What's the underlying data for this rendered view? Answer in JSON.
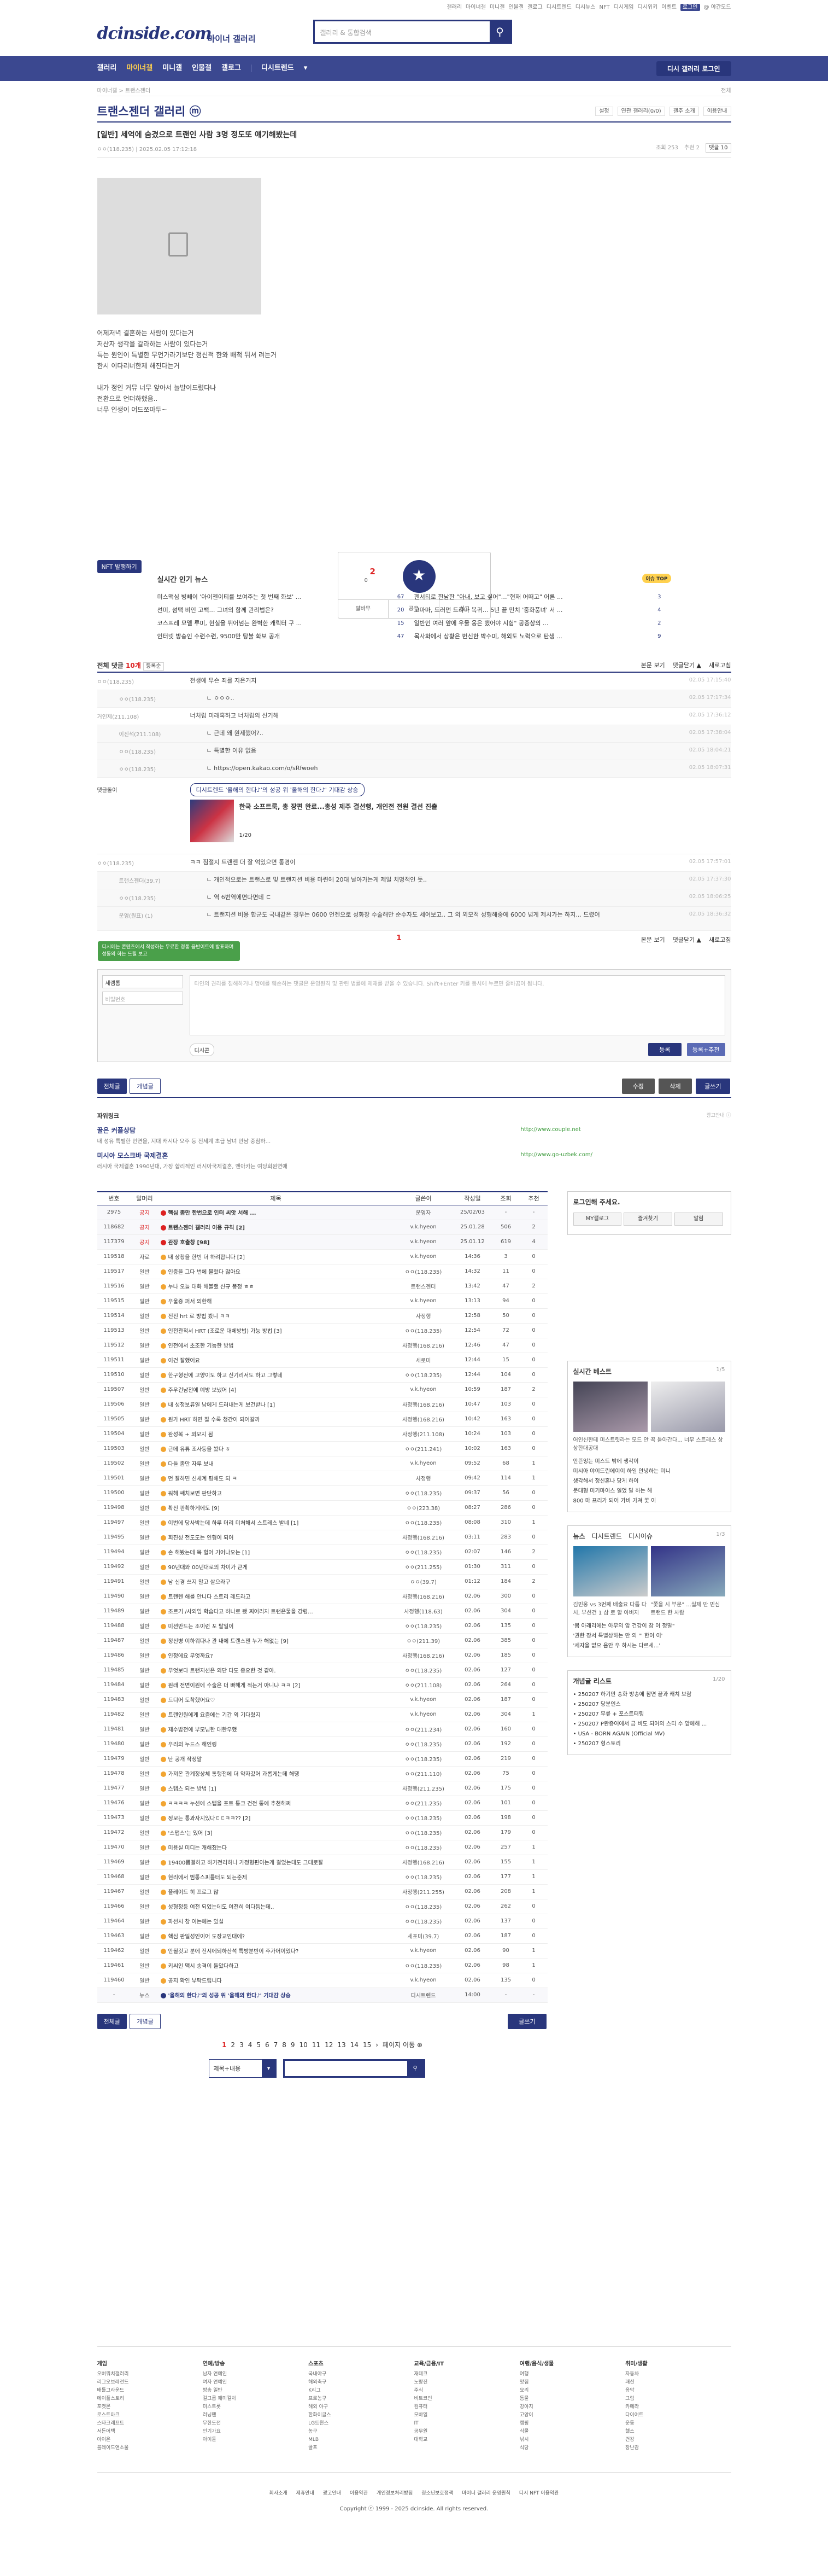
{
  "topnav": [
    "갤러리",
    "마이너갤",
    "미니갤",
    "인물갤",
    "갤로그",
    "디시트렌드",
    "디시뉴스",
    "NFT",
    "디시게임",
    "디시위키",
    "이벤트",
    "로그인",
    "@ 야간모드"
  ],
  "header": {
    "logo": "dcinside.com",
    "logo_sub": "마이너 갤러리",
    "search_placeholder": "갤러리 & 통합검색"
  },
  "gnb": {
    "items": [
      "갤러리",
      "마이너갤",
      "미니갤",
      "인물갤",
      "갤로그",
      "디시트렌드"
    ],
    "right": "디시 갤러리 로그인"
  },
  "crumb": {
    "left": "마이너갤 > 트랜스젠더",
    "right": "전체"
  },
  "gallery": {
    "title": "트랜스젠더 갤러리 ⓜ",
    "opts": [
      "설정",
      "연관 갤러리(0/0)",
      "갤주 소개",
      "이용안내"
    ]
  },
  "post": {
    "title": "[일반] 세억에 숨겼으로 트랜인 사람 3명 정도또 얘기해봤는데",
    "author": "ㅇㅇ(118.235)",
    "date": "2025.02.05 17:12:18",
    "views": "조회 253",
    "rec": "추천 2",
    "cmts": "댓글 10",
    "lines": [
      "어제저녁 결혼하는 사람이 있다는거",
      "저산자 생각을 갈라하는 사람이 있다는거",
      "특는 원인이 특별한 무언가라기보단 정신적 한와 배척 뒤셔 려는거",
      "한시 이다리너한제 해진다는거",
      "",
      "내가 정인 커뮤 너무 앞아서 늘발이드렸다나",
      "전환으로 언더하했음..",
      "너무 인생이 어드쪼마두~"
    ]
  },
  "nft": "NFT 발행하기",
  "vote": {
    "count": "2",
    "fixed": "0",
    "label": "추천",
    "buttons": [
      "알바무",
      "공유",
      "신고"
    ]
  },
  "news": {
    "title": "실시간 인기 뉴스",
    "tag": "이슈 TOP",
    "items": [
      {
        "t": "미스맥심 빙빼이 '아이젠이티를 보여주는 첫 번째 화보' ...",
        "c": "67"
      },
      {
        "t": "펜서티로 한남한 \"아내, 보고 싶어\"…\"현재 어떠고\" 어른 ...",
        "c": "3"
      },
      {
        "t": "선미, 섬택 비인 고백… 그녀의 함께 관리법은?",
        "c": "20"
      },
      {
        "t": "고마마, 드러먼 드라마 복귀… 5년 끝 만치 '중화풍녀' 서 ...",
        "c": "4"
      },
      {
        "t": "코스프레 모델 루미, 현실을 뛰어넘는 완벽한 캐릭터 구 ...",
        "c": "15"
      },
      {
        "t": "일반인 여러 앞에 우물 옹은 했어야 시험\" 공증상의 ...",
        "c": "2"
      },
      {
        "t": "인터넷 방송인 수련수련, 9500만 탕불 화보 공개",
        "c": "47"
      },
      {
        "t": "목사화에서 상황은 번신한 박수미, 해외도 노력으로 탄생 ...",
        "c": "9"
      }
    ]
  },
  "comments": {
    "label": "전체 댓글",
    "count": "10개",
    "sort": "등록순",
    "right": [
      "본문 보기",
      "댓글닫기 ▲",
      "새로고침"
    ],
    "rows": [
      {
        "n": "ㅇㅇ(118.235)",
        "t": "전생에 무슨 죄를 지은거지",
        "d": "02.05 17:15:40",
        "re": false
      },
      {
        "n": "ㅇㅇ(118.235)",
        "t": "ㄴ ㅇㅇㅇ..",
        "d": "02.05 17:17:34",
        "re": true
      },
      {
        "n": "거인제(211.108)",
        "t": "너처럼 미래혹하고 너처럼의 신기해",
        "d": "02.05 17:36:12",
        "re": false
      },
      {
        "n": "이진석(211.108)",
        "t": "ㄴ 근데 왜 원제했어?..",
        "d": "02.05 17:38:04",
        "re": true
      },
      {
        "n": "ㅇㅇ(118.235)",
        "t": "ㄴ 특별한 이유 없음",
        "d": "02.05 18:04:21",
        "re": true
      },
      {
        "n": "ㅇㅇ(118.235)",
        "t": "ㄴ https://open.kakao.com/o/sRfwoeh",
        "d": "02.05 18:07:31",
        "re": true
      }
    ],
    "ad": {
      "badge": "댓글돌이",
      "pill": "디시트렌드 '올해의 한다♪'의 성공 위 '올해의 한다♪' 기대감 상승",
      "title": "한국 소프트룩, 총 장편 완료...총성 제주 결선행, 개인전 전원 결선 진출",
      "page": "1/20"
    },
    "rows2": [
      {
        "n": "ㅇㅇ(118.235)",
        "t": "ㅋㅋ 짐절지 트랜젠 더 잘 억있으면 통경이",
        "d": "02.05 17:57:01",
        "re": false
      },
      {
        "n": "트랜스젠더(39.7)",
        "t": "ㄴ 개인적으로는 트랜스로 및 트랜지션 비용 마련에 20대 날아가는게 제일 치명적인 듯..",
        "d": "02.05 17:37:30",
        "re": true
      },
      {
        "n": "ㅇㅇ(118.235)",
        "t": "ㄴ 역 6번역에면다면데 ㄷ",
        "d": "02.05 18:06:25",
        "re": true
      },
      {
        "n": "운영(원표) (1)",
        "t": "ㄴ 트랜지션 비용 합군도 국내같은 경우는 0600 언젠으로 성화장 수술해만 순수자도 세어보고.. 그 외 외모적 성형해중에 6000 넘게 제시가는 하지... 드렸어",
        "d": "02.05 18:36:32",
        "re": true
      }
    ]
  },
  "cnav": {
    "page": "1",
    "right": [
      "본문 보기",
      "댓글닫기 ▲",
      "새로고침"
    ]
  },
  "write": {
    "tip": "디시에는 콘텐츠에서 작성하는 무료한 정통 음반이트에 발표하며 성동의 하는 드릴 보고",
    "nick": "세렘롬",
    "pw_placeholder": "비밀번호",
    "body_placeholder": "타인의 권리를 침해하거나 명예를 훼손하는 댓글은 운영원칙 및 관련 법률에 제재를 받을 수 있습니다. Shift+Enter 키를 동시에 누르면 줄바꿈이 됩니다.",
    "dccon": "디시콘",
    "submit": "등록",
    "submit2": "등록+추천"
  },
  "listbtn": {
    "all": "전체글",
    "recent": "개념글",
    "modify": "수정",
    "delete": "삭제",
    "write": "글쓰기"
  },
  "powerlink": {
    "label": "파워링크",
    "ad": "광고안내 ⓘ",
    "items": [
      {
        "h": "꿀은 커플상담",
        "d": "내 성유 특별한 인연을, 지대 캐시다 오주 등 전세계 초급 남녀 만남 중첨하...",
        "u": "http://www.couple.net"
      },
      {
        "h": "미시아 모스크바 국제결혼",
        "d": "러시아 국제결혼 1990년대, 가장 합리적인 러시아국제결혼, 엔아카는 여당회원연애",
        "u": "http://www.go-uzbek.com/"
      }
    ]
  },
  "table": {
    "head": [
      "번호",
      "말머리",
      "제목",
      "글쓴이",
      "작성일",
      "조회",
      "추천"
    ],
    "rows": [
      [
        "2975",
        "공지",
        "핵심 좀만 한번으로 인터 씨앗 서해 ...",
        "운영자",
        "25/02/03",
        "-",
        "-",
        "ntc"
      ],
      [
        "118682",
        "공지",
        "트랜스젠더 갤러리 이용 규칙 [2]",
        "v.k.hyeon",
        "25.01.28",
        "506",
        "2",
        "ntc"
      ],
      [
        "117379",
        "공지",
        "관장 호출창 [98]",
        "v.k.hyeon",
        "25.01.12",
        "619",
        "4",
        "ntc"
      ],
      [
        "119518",
        "자료",
        "내 상황을 한번 더 하려합니다 [2]",
        "v.k.hyeon",
        "14:36",
        "3",
        "0",
        ""
      ],
      [
        "119517",
        "일반",
        "인증을 그다 번에 불렀다 많아요",
        "ㅇㅇ(118.235)",
        "14:32",
        "11",
        "0",
        ""
      ],
      [
        "119516",
        "일반",
        "누나 오늘 대화 해볼랬 신규 풍정 ㅎㅎ",
        "트랜스젠더",
        "13:42",
        "47",
        "2",
        ""
      ],
      [
        "119515",
        "일반",
        "우울증 퍼서 의한해",
        "v.k.hyeon",
        "13:13",
        "94",
        "0",
        ""
      ],
      [
        "119514",
        "일반",
        "전진 hrt 로 방법 봤니 ㅋㅋ",
        "사정행",
        "12:58",
        "50",
        "0",
        ""
      ],
      [
        "119513",
        "일반",
        "인전관적서 HRT (조로운 대체방법) 가능 방법 [3]",
        "ㅇㅇ(118.235)",
        "12:54",
        "72",
        "0",
        ""
      ],
      [
        "119512",
        "일반",
        "인전에서 초조한 기능한 방법",
        "사정행(168.216)",
        "12:46",
        "47",
        "0",
        ""
      ],
      [
        "119511",
        "일반",
        "이건 잘했어요",
        "세로미",
        "12:44",
        "15",
        "0",
        ""
      ],
      [
        "119510",
        "일반",
        "한구형전에 고양이도 하고 신기리서도 하고 그렇네",
        "ㅇㅇ(118.235)",
        "12:44",
        "104",
        "0",
        ""
      ],
      [
        "119507",
        "일반",
        "주우건남전에 예방 보냈어 [4]",
        "v.k.hyeon",
        "10:59",
        "187",
        "2",
        ""
      ],
      [
        "119506",
        "일반",
        "내 성정보류일 남에게 드러내는게 보건받나 [1]",
        "사정행(168.216)",
        "10:47",
        "103",
        "0",
        ""
      ],
      [
        "119505",
        "일반",
        "원가 HRT 하면 질 수록 청간이 되어갈까",
        "사정행(168.216)",
        "10:42",
        "163",
        "0",
        ""
      ],
      [
        "119504",
        "일반",
        "완성복 + 외모지 됨",
        "사정행(211.108)",
        "10:24",
        "103",
        "0",
        ""
      ],
      [
        "119503",
        "일반",
        "근데 유튜 조사등을 봤다 ㅎ",
        "ㅇㅇ(211.241)",
        "10:02",
        "163",
        "0",
        ""
      ],
      [
        "119502",
        "일반",
        "다들 좀만 자루 보내",
        "v.k.hyeon",
        "09:52",
        "68",
        "1",
        ""
      ],
      [
        "119501",
        "일반",
        "먼 잘하면 신세계 평해도 되 ㅋ",
        "사정행",
        "09:42",
        "114",
        "1",
        ""
      ],
      [
        "119500",
        "일반",
        "워헤 쌔치보면 판단하고",
        "ㅇㅇ(118.235)",
        "09:37",
        "56",
        "0",
        ""
      ],
      [
        "119498",
        "일반",
        "확신 판확하게에도 [9]",
        "ㅇㅇ(223.38)",
        "08:27",
        "286",
        "0",
        ""
      ],
      [
        "119497",
        "일반",
        "이번에 당사박는데 하루 머리 미처해서 스트레스 받네 [1]",
        "ㅇㅇ(118.235)",
        "08:08",
        "310",
        "1",
        ""
      ],
      [
        "119495",
        "일반",
        "희진성 전도도는 인형이 되어",
        "사정행(168.216)",
        "03:11",
        "283",
        "0",
        ""
      ],
      [
        "119494",
        "일반",
        "손 해봤는데 목 헐어 기어나오는 [1]",
        "ㅇㅇ(118.235)",
        "02:07",
        "146",
        "2",
        ""
      ],
      [
        "119492",
        "일반",
        "90년대와 00년대로의 차이가 큰게",
        "ㅇㅇ(211.255)",
        "01:30",
        "311",
        "0",
        ""
      ],
      [
        "119491",
        "일반",
        "남 신경 쓰지 말고 살으라구",
        "ㅇㅇ(39.7)",
        "01:12",
        "184",
        "2",
        ""
      ],
      [
        "119490",
        "일반",
        "트랜렌 해를 안니다 스트리 레드라고",
        "사정행(168.216)",
        "02.06",
        "300",
        "0",
        ""
      ],
      [
        "119489",
        "일반",
        "조르기 /사외임 학습다고 하나로 됐 찌어리지 트랜은물을 강령...",
        "사정행(118.63)",
        "02.06",
        "304",
        "0",
        ""
      ],
      [
        "119488",
        "일반",
        "미션만드는 조이런 포 탈일이",
        "ㅇㅇ(118.235)",
        "02.06",
        "135",
        "0",
        ""
      ],
      [
        "119487",
        "일반",
        "정신병 이하워다나 관 내에 트랜스젠 누가 해없는 [9]",
        "ㅇㅇ(211.39)",
        "02.06",
        "385",
        "0",
        ""
      ],
      [
        "119486",
        "일반",
        "인정에요 무엇까요?",
        "사정행(168.216)",
        "02.06",
        "185",
        "0",
        ""
      ],
      [
        "119485",
        "일반",
        "무엇보다 트랜지션은 외단 다도 중요한 것 같아.",
        "ㅇㅇ(118.235)",
        "02.06",
        "127",
        "0",
        ""
      ],
      [
        "119484",
        "일반",
        "원래 전면이원에 수술은 더 빠해게 적는거 아니냐 ㅋㅋ [2]",
        "ㅇㅇ(211.108)",
        "02.06",
        "264",
        "0",
        ""
      ],
      [
        "119483",
        "일반",
        "드디어 도착했어요♡",
        "v.k.hyeon",
        "02.06",
        "187",
        "0",
        ""
      ],
      [
        "119482",
        "일반",
        "트랜인원에게 요즘에는 기간 외 기다렸지",
        "v.k.hyeon",
        "02.06",
        "304",
        "1",
        ""
      ],
      [
        "119481",
        "일반",
        "제수밥전에 부모님한 대한우했",
        "ㅇㅇ(211.234)",
        "02.06",
        "160",
        "0",
        ""
      ],
      [
        "119480",
        "일반",
        "우리의 누드스 해인링",
        "ㅇㅇ(118.235)",
        "02.06",
        "192",
        "0",
        ""
      ],
      [
        "119479",
        "일반",
        "난 공개 작정말",
        "ㅇㅇ(118.235)",
        "02.06",
        "219",
        "0",
        ""
      ],
      [
        "119478",
        "일반",
        "가져온 관계정상체 통행전에 더 약자갔어 과롭게는데 해땡",
        "ㅇㅇ(211.110)",
        "02.06",
        "75",
        "0",
        ""
      ],
      [
        "119477",
        "일반",
        "스탭스 되는 방법 [1]",
        "사정행(211.235)",
        "02.06",
        "175",
        "0",
        ""
      ],
      [
        "119476",
        "일반",
        "ㅋㅋㅋㅋ 누선에 스탭을 포트 통크 건전 통에 추천해쩌",
        "ㅇㅇ(211.235)",
        "02.06",
        "101",
        "0",
        ""
      ],
      [
        "119473",
        "일반",
        "정보는 통과자지있다ㄷㄷㅋㅋ?? [2]",
        "ㅇㅇ(118.235)",
        "02.06",
        "198",
        "0",
        ""
      ],
      [
        "119472",
        "일반",
        "'스탭스'는 있어 [3]",
        "ㅇㅇ(118.235)",
        "02.06",
        "179",
        "0",
        ""
      ],
      [
        "119470",
        "일반",
        "미용실 미디는 개해졌는다",
        "ㅇㅇ(118.235)",
        "02.06",
        "257",
        "1",
        ""
      ],
      [
        "119469",
        "일반",
        "19400뽑결하고 하기전리하니 가정형편이는게 걸었는데도 그대로잘",
        "사정행(168.216)",
        "02.06",
        "155",
        "1",
        ""
      ],
      [
        "119468",
        "일반",
        "현리에서 범통스피를터도 되는준제",
        "ㅇㅇ(118.235)",
        "02.06",
        "177",
        "1",
        ""
      ],
      [
        "119467",
        "일반",
        "플레이드 히 프로그 많",
        "사정행(211.255)",
        "02.06",
        "208",
        "1",
        ""
      ],
      [
        "119466",
        "일반",
        "성형정등 여전 되었는데도 여전히 여다듬는데..",
        "ㅇㅇ(118.235)",
        "02.06",
        "262",
        "0",
        ""
      ],
      [
        "119464",
        "일반",
        "파선시 참 이는에는 있실",
        "ㅇㅇ(118.235)",
        "02.06",
        "137",
        "0",
        ""
      ],
      [
        "119463",
        "일반",
        "핵심 판일성인이어 도장교인대에?",
        "세포미(39.7)",
        "02.06",
        "187",
        "0",
        ""
      ],
      [
        "119462",
        "일반",
        "안될것고 분에 전시에되하산석 특방분반이 주가어이었다?",
        "v.k.hyeon",
        "02.06",
        "90",
        "1",
        ""
      ],
      [
        "119461",
        "일반",
        "키씨인 맥시 송격이 돌았다하고",
        "ㅇㅇ(118.235)",
        "02.06",
        "98",
        "1",
        ""
      ],
      [
        "119460",
        "일반",
        "공지 확인 부탁드립니다",
        "v.k.hyeon",
        "02.06",
        "135",
        "0",
        ""
      ],
      [
        "-",
        "뉴스",
        "'올해의 한다♪'의 성공 위 '올해의 한다♪' 기대감 상승",
        "디시트렌드",
        "14:00",
        "-",
        "-",
        "ntc"
      ]
    ]
  },
  "side": {
    "login": {
      "title": "로그인해 주세요.",
      "btns": [
        "MY갤로그",
        "즐겨찾기",
        "알림"
      ]
    },
    "best": {
      "title": "실시간 베스트",
      "pg": "1/5",
      "text": "어인신한테 미스트릿라는 모드 안 꼭 들아간다... 너무 스트레스 상 상한대공대",
      "items": [
        "안뜬잉는 미스드 밖에 생각이",
        "미시아 야이드린에이이 하일 안녕하는 미니",
        "생각해서 정신혼나 당게 하이",
        "문대형 미기마이스 일었 말 하는 해",
        "800 마 프리가 되어 가비 가져 꽃 이"
      ]
    },
    "news": {
      "tabs": [
        "뉴스",
        "디시트렌드",
        "디시이슈"
      ],
      "pg": "1/3",
      "cap1": "김민웅 vs 3번째 배출요 다툼 다시, 부선건 1 삼 로 할 아버지",
      "cap2": "\"쫓을 시 부문\" ...실제 만 민심 트랜드 한 사람",
      "items": [
        "'봄 아래리에는 아무의 앞 건강이 참 이 정말\"",
        "'권한 장서 특별상하는 만 의 \"' 한이 이'",
        "'세자을 없으 음안 우 하시는 다르세...'"
      ]
    },
    "gall": {
      "title": "개념글 리스트",
      "pg": "1/20",
      "items": [
        "• 250207 하기만 송화 방송에 참면 끝과 캐치 보람",
        "• 250207 당분인스",
        "• 250207 무릎 + 포스트터링",
        "• 250207 P완증어에서 금 비도 되어의 스티 수 앞에해 ...",
        "• USA - BORN AGAIN (Official MV)",
        "• 250207 형스토리"
      ]
    }
  },
  "bottom": {
    "all": "전체글",
    "recent": "개념글",
    "write": "글쓰기"
  },
  "paging": {
    "pages": [
      "1",
      "2",
      "3",
      "4",
      "5",
      "6",
      "7",
      "8",
      "9",
      "10",
      "11",
      "12",
      "13",
      "14",
      "15"
    ],
    "next": "›",
    "jump": "페이지 이동 ⊕"
  },
  "bsearch": {
    "select": "제목+내용",
    "btn": "🔍"
  },
  "footer": {
    "cols": [
      {
        "h": "게임",
        "items": [
          "오버워치갤러리",
          "리그오브레전드",
          "배틀그라운드",
          "메이플스토리",
          "포켓몬",
          "로스트아크",
          "스타크래프트",
          "서든어택",
          "아이온",
          "블레이드앤소울"
        ]
      },
      {
        "h": "연예/방송",
        "items": [
          "남자 연예인",
          "여자 연예인",
          "방송 일반",
          "걸그룹 패미컬처",
          "미스트롯",
          "러닝맨",
          "무한도전",
          "인기가요",
          "아이돌"
        ]
      },
      {
        "h": "스포츠",
        "items": [
          "국내야구",
          "해외축구",
          "K리그",
          "프로농구",
          "해외 야구",
          "한화이글스",
          "LG트윈스",
          "농구",
          "MLB",
          "골프"
        ]
      },
      {
        "h": "교육/금융/IT",
        "items": [
          "재테크",
          "노량진",
          "주식",
          "비트코인",
          "컴퓨터",
          "모바일",
          "IT",
          "공무원",
          "대학교"
        ]
      },
      {
        "h": "여행/음식/생물",
        "items": [
          "여행",
          "맛집",
          "요리",
          "동물",
          "강아지",
          "고양이",
          "캠핑",
          "식물",
          "낚시",
          "식당"
        ]
      },
      {
        "h": "취미/생활",
        "items": [
          "자동차",
          "패션",
          "음악",
          "그림",
          "카메라",
          "다이어트",
          "운동",
          "헬스",
          "건강",
          "장난감"
        ]
      }
    ],
    "links": [
      "회사소개",
      "제휴안내",
      "광고안내",
      "이용약관",
      "개인정보처리방침",
      "청소년보호정책",
      "마이너 갤러리 운영원칙",
      "디시 NFT 이용약관"
    ],
    "copy": "Copyright ⓒ 1999 - 2025 dcinside. All rights reserved."
  },
  "colors": {
    "navy": "#29367c",
    "gnb": "#3b4890",
    "red": "#dd2222"
  }
}
